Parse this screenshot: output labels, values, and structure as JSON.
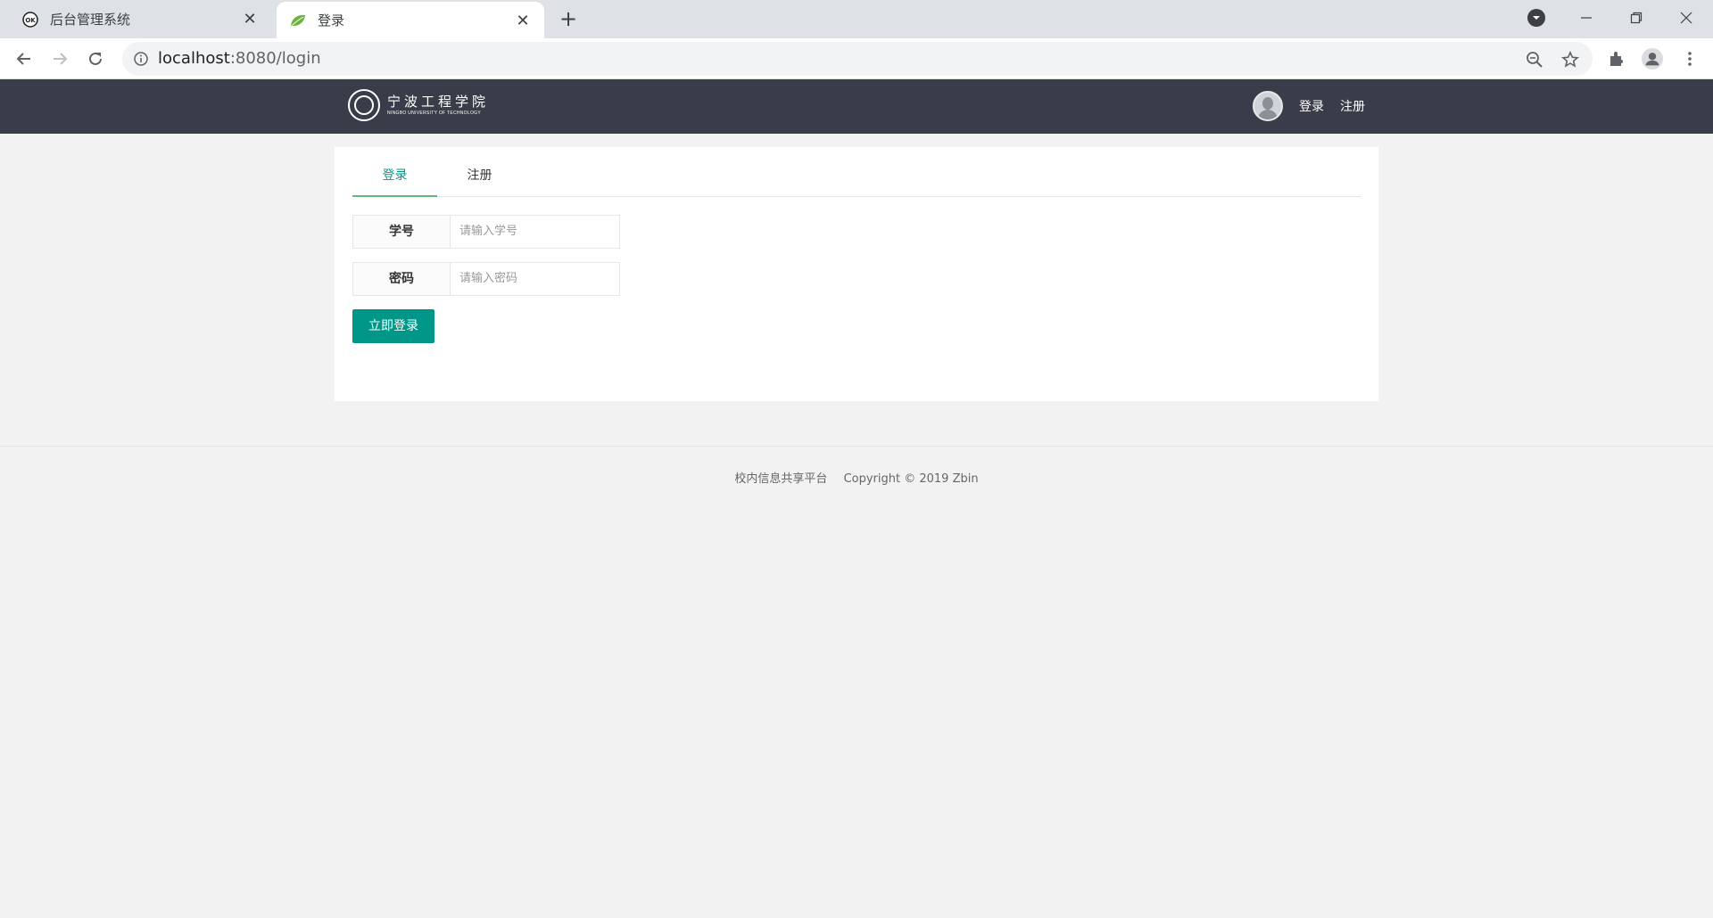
{
  "browser": {
    "tabs": [
      {
        "title": "后台管理系统",
        "favicon": "ok-icon",
        "active": false
      },
      {
        "title": "登录",
        "favicon": "leaf-icon",
        "active": true
      }
    ],
    "url_host": "localhost",
    "url_rest": ":8080/login"
  },
  "header": {
    "logo_cn": "宁波工程学院",
    "logo_en": "NINGBO UNIVERSITY OF TECHNOLOGY",
    "login_link": "登录",
    "register_link": "注册"
  },
  "card": {
    "tabs": [
      {
        "label": "登录",
        "active": true
      },
      {
        "label": "注册",
        "active": false
      }
    ],
    "fields": [
      {
        "label": "学号",
        "placeholder": "请输入学号"
      },
      {
        "label": "密码",
        "placeholder": "请输入密码"
      }
    ],
    "submit_label": "立即登录"
  },
  "footer": {
    "site": "校内信息共享平台",
    "copyright": "Copyright  © 2019 Zbin"
  },
  "colors": {
    "header_bg": "#393d49",
    "accent": "#009688",
    "tab_underline": "#5fb878",
    "page_bg": "#f2f2f2"
  }
}
